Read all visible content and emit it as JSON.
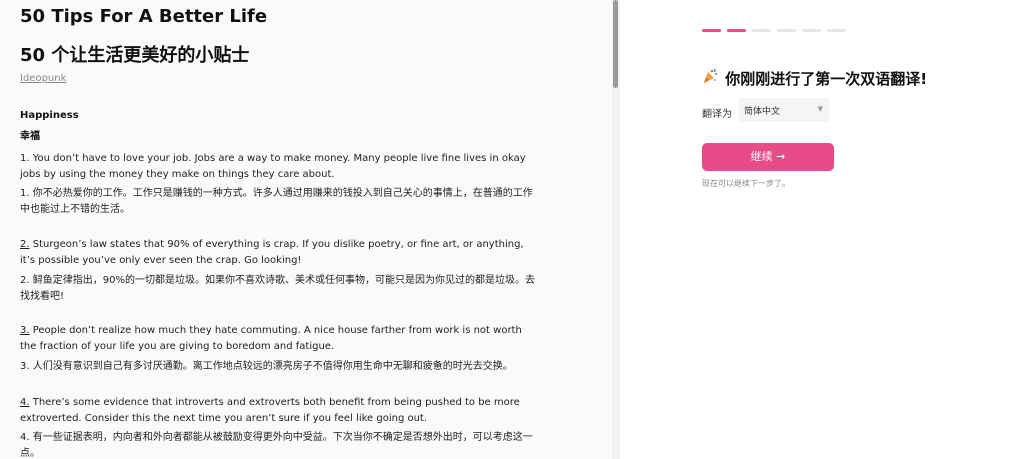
{
  "article": {
    "title_en": "50 Tips For A Better Life",
    "title_zh": "50 个让生活更美好的小贴士",
    "author": "Ideopunk",
    "section_en": "Happiness",
    "section_zh": "幸福",
    "tips": [
      {
        "en_num": "1.",
        "en": " You don’t have to love your job. Jobs are a way to make money. Many people live fine lives in okay jobs by using the money they make on things they care about.",
        "zh": "1. 你不必热爱你的工作。工作只是赚钱的一种方式。许多人通过用赚来的钱投入到自己关心的事情上，在普通的工作中也能过上不错的生活。"
      },
      {
        "en_num": "2.",
        "en": " Sturgeon’s law states that 90% of everything is crap. If you dislike poetry, or fine art, or anything, it’s possible you’ve only ever seen the crap. Go looking!",
        "zh": "2. 鲟鱼定律指出，90%的一切都是垃圾。如果你不喜欢诗歌、美术或任何事物，可能只是因为你见过的都是垃圾。去找找看吧!"
      },
      {
        "en_num": "3.",
        "en": " People don’t realize how much they hate commuting. A nice house farther from work is not worth the fraction of your life you are giving to boredom and fatigue.",
        "zh": "3. 人们没有意识到自己有多讨厌通勤。离工作地点较远的漂亮房子不值得你用生命中无聊和疲惫的时光去交换。"
      },
      {
        "en_num": "4.",
        "en": " There’s some evidence that introverts and extroverts both benefit from being pushed to be more extroverted. Consider this the next time you aren’t sure if you feel like going out.",
        "zh": "4. 有一些证据表明，内向者和外向者都能从被鼓励变得更外向中受益。下次当你不确定是否想外出时，可以考虑这一点。"
      }
    ]
  },
  "panel": {
    "progress_total": 6,
    "progress_active": [
      1,
      2
    ],
    "congrats_icon": "party-popper-icon",
    "congrats": "你刚刚进行了第一次双语翻译!",
    "translate_to_label": "翻译为",
    "selected_language": "简体中文",
    "continue_label": "继续 →",
    "hint": "现在可以继续下一步了。"
  },
  "colors": {
    "accent": "#e84c88",
    "left_bg": "#fafaf8"
  }
}
